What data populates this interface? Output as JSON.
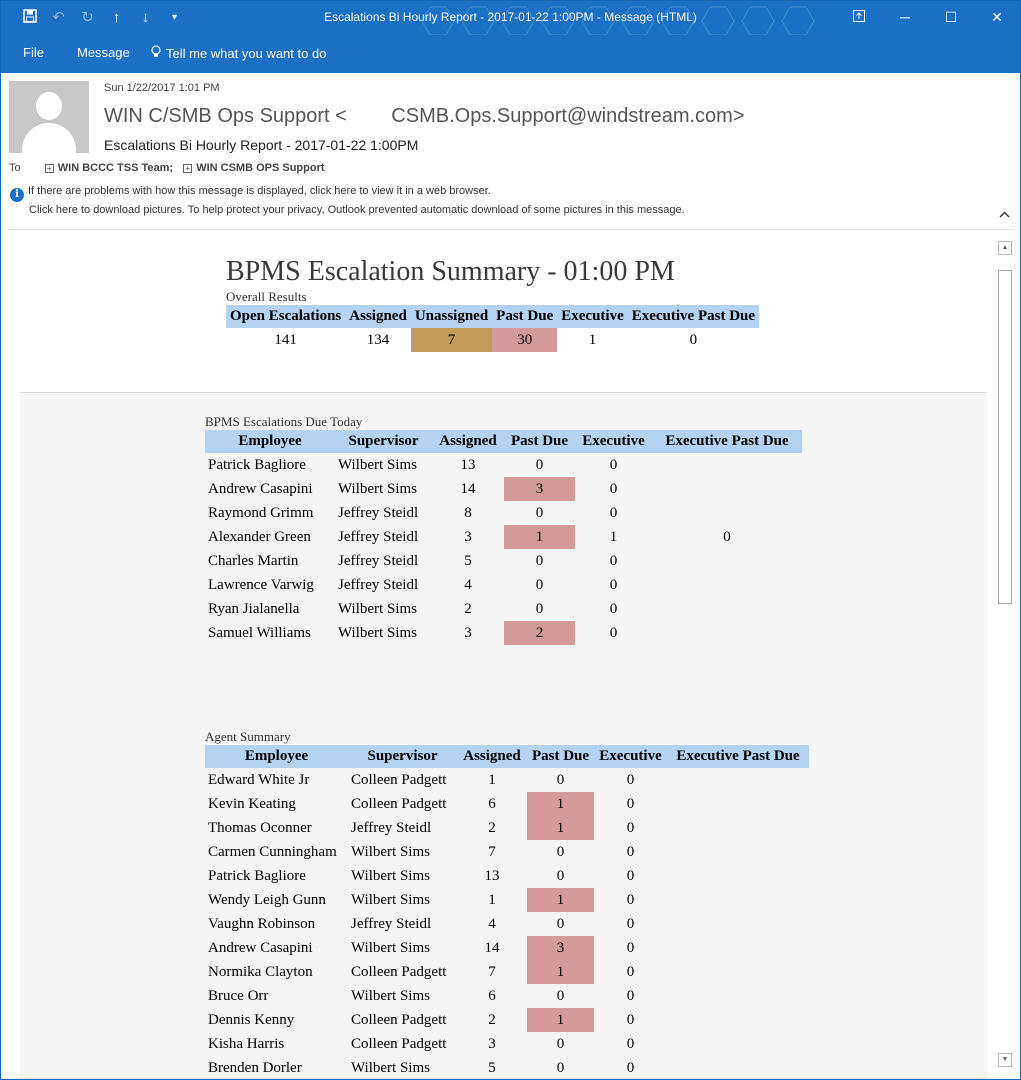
{
  "window": {
    "title": "Escalations Bi Hourly Report - 2017-01-22 1:00PM  -  Message (HTML)",
    "qat_icons": [
      "save-icon",
      "undo-icon",
      "redo-icon",
      "up-arrow-icon",
      "down-arrow-icon",
      "customize-icon"
    ],
    "caption_buttons": [
      "restore-window-icon",
      "minimize-icon",
      "maximize-icon",
      "close-icon"
    ]
  },
  "menu": {
    "file": "File",
    "message": "Message",
    "tell_me": "Tell me what you want to do"
  },
  "header": {
    "sent": "Sun 1/22/2017 1:01 PM",
    "from": "WIN C/SMB Ops Support <        CSMB.Ops.Support@windstream.com>",
    "subject": "Escalations Bi Hourly Report - 2017-01-22 1:00PM",
    "to_label": "To",
    "recipients": [
      "WIN BCCC TSS Team;",
      "WIN CSMB OPS Support"
    ],
    "info_line1": "If there are problems with how this message is displayed, click here to view it in a web browser.",
    "info_line2": "Click here to download pictures. To help protect your privacy, Outlook prevented automatic download of some pictures in this message."
  },
  "report": {
    "title": "BPMS Escalation Summary - 01:00 PM",
    "overall": {
      "caption": "Overall Results",
      "headers": [
        "Open Escalations",
        "Assigned",
        "Unassigned",
        "Past Due",
        "Executive",
        "Executive Past Due"
      ],
      "values": [
        "141",
        "134",
        "7",
        "30",
        "1",
        "0"
      ]
    },
    "due_today": {
      "caption": "BPMS Escalations Due Today",
      "headers": [
        "Employee",
        "Supervisor",
        "Assigned",
        "Past Due",
        "Executive",
        "Executive Past Due"
      ],
      "rows": [
        [
          "Patrick Bagliore",
          "Wilbert Sims",
          "13",
          "0",
          "0",
          ""
        ],
        [
          "Andrew Casapini",
          "Wilbert Sims",
          "14",
          "3",
          "0",
          ""
        ],
        [
          "Raymond Grimm",
          "Jeffrey Steidl",
          "8",
          "0",
          "0",
          ""
        ],
        [
          "Alexander Green",
          "Jeffrey Steidl",
          "3",
          "1",
          "1",
          "0"
        ],
        [
          "Charles Martin",
          "Jeffrey Steidl",
          "5",
          "0",
          "0",
          ""
        ],
        [
          "Lawrence Varwig",
          "Jeffrey Steidl",
          "4",
          "0",
          "0",
          ""
        ],
        [
          "Ryan Jialanella",
          "Wilbert Sims",
          "2",
          "0",
          "0",
          ""
        ],
        [
          "Samuel Williams",
          "Wilbert Sims",
          "3",
          "2",
          "0",
          ""
        ]
      ]
    },
    "agent_summary": {
      "caption": "Agent Summary",
      "headers": [
        "Employee",
        "Supervisor",
        "Assigned",
        "Past Due",
        "Executive",
        "Executive Past Due"
      ],
      "rows": [
        [
          "Edward White Jr",
          "Colleen Padgett",
          "1",
          "0",
          "0",
          ""
        ],
        [
          "Kevin Keating",
          "Colleen Padgett",
          "6",
          "1",
          "0",
          ""
        ],
        [
          "Thomas Oconner",
          "Jeffrey Steidl",
          "2",
          "1",
          "0",
          ""
        ],
        [
          "Carmen Cunningham",
          "Wilbert Sims",
          "7",
          "0",
          "0",
          ""
        ],
        [
          "Patrick Bagliore",
          "Wilbert Sims",
          "13",
          "0",
          "0",
          ""
        ],
        [
          "Wendy Leigh Gunn",
          "Wilbert Sims",
          "1",
          "1",
          "0",
          ""
        ],
        [
          "Vaughn Robinson",
          "Jeffrey Steidl",
          "4",
          "0",
          "0",
          ""
        ],
        [
          "Andrew Casapini",
          "Wilbert Sims",
          "14",
          "3",
          "0",
          ""
        ],
        [
          "Normika Clayton",
          "Colleen Padgett",
          "7",
          "1",
          "0",
          ""
        ],
        [
          "Bruce Orr",
          "Wilbert Sims",
          "6",
          "0",
          "0",
          ""
        ],
        [
          "Dennis Kenny",
          "Colleen Padgett",
          "2",
          "1",
          "0",
          ""
        ],
        [
          "Kisha Harris",
          "Colleen Padgett",
          "3",
          "0",
          "0",
          ""
        ],
        [
          "Brenden Dorler",
          "Wilbert Sims",
          "5",
          "0",
          "0",
          ""
        ]
      ]
    }
  },
  "colors": {
    "title_bar": "#1b6fc4",
    "table_header": "#b4d3f2",
    "unassigned_highlight": "#c49a58",
    "past_due_highlight": "#d4999b"
  }
}
